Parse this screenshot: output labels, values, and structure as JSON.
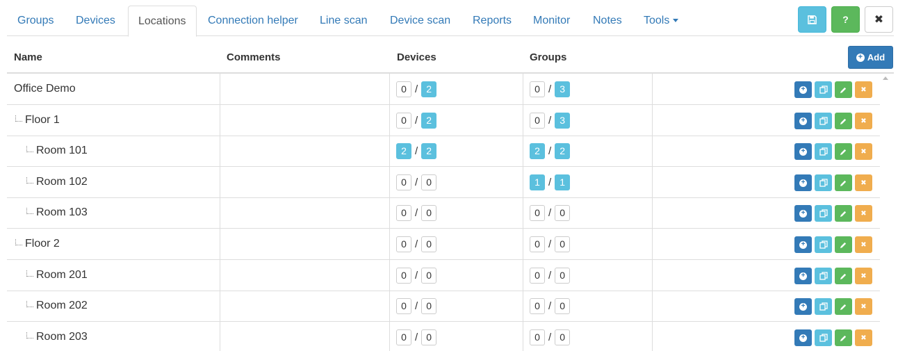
{
  "tabs": [
    {
      "label": "Groups",
      "active": false
    },
    {
      "label": "Devices",
      "active": false
    },
    {
      "label": "Locations",
      "active": true
    },
    {
      "label": "Connection helper",
      "active": false
    },
    {
      "label": "Line scan",
      "active": false
    },
    {
      "label": "Device scan",
      "active": false
    },
    {
      "label": "Reports",
      "active": false
    },
    {
      "label": "Monitor",
      "active": false
    },
    {
      "label": "Notes",
      "active": false
    },
    {
      "label": "Tools",
      "active": false,
      "dropdown": true
    }
  ],
  "toolbar": {
    "save_icon": "save-icon",
    "help_label": "?",
    "close_label": "✖"
  },
  "table": {
    "columns": {
      "name": "Name",
      "comments": "Comments",
      "devices": "Devices",
      "groups": "Groups"
    },
    "add_label": "Add",
    "rows": [
      {
        "name": "Office Demo",
        "level": 0,
        "comment": "",
        "devices": [
          0,
          2
        ],
        "groups": [
          0,
          3
        ]
      },
      {
        "name": "Floor 1",
        "level": 1,
        "comment": "",
        "devices": [
          0,
          2
        ],
        "groups": [
          0,
          3
        ]
      },
      {
        "name": "Room 101",
        "level": 2,
        "comment": "",
        "devices": [
          2,
          2
        ],
        "groups": [
          2,
          2
        ]
      },
      {
        "name": "Room 102",
        "level": 2,
        "comment": "",
        "devices": [
          0,
          0
        ],
        "groups": [
          1,
          1
        ]
      },
      {
        "name": "Room 103",
        "level": 2,
        "comment": "",
        "devices": [
          0,
          0
        ],
        "groups": [
          0,
          0
        ]
      },
      {
        "name": "Floor 2",
        "level": 1,
        "comment": "",
        "devices": [
          0,
          0
        ],
        "groups": [
          0,
          0
        ]
      },
      {
        "name": "Room 201",
        "level": 2,
        "comment": "",
        "devices": [
          0,
          0
        ],
        "groups": [
          0,
          0
        ]
      },
      {
        "name": "Room 202",
        "level": 2,
        "comment": "",
        "devices": [
          0,
          0
        ],
        "groups": [
          0,
          0
        ]
      },
      {
        "name": "Room 203",
        "level": 2,
        "comment": "",
        "devices": [
          0,
          0
        ],
        "groups": [
          0,
          0
        ]
      }
    ]
  },
  "colors": {
    "link": "#337ab7",
    "primary": "#337ab7",
    "info": "#5bc0de",
    "success": "#5cb85c",
    "warning": "#f0ad4e"
  }
}
